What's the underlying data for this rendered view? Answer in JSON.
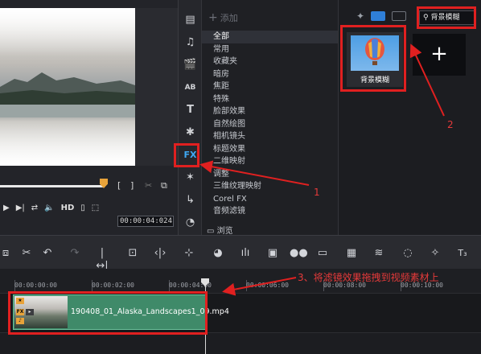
{
  "preview": {
    "mark_in": "[",
    "mark_out": "]",
    "hd_label": "HD",
    "timecode": "00:00:04:024"
  },
  "library_toolbar": {
    "fx_label": "FX"
  },
  "categories": {
    "add_label": "添加",
    "items": [
      "全部",
      "常用",
      "收藏夹",
      "暗房",
      "焦距",
      "特殊",
      "脸部效果",
      "自然绘图",
      "相机镜头",
      "标题效果",
      "二维映射",
      "调整",
      "三维纹理映射",
      "Corel FX",
      "音频滤镜"
    ],
    "selected_index": 0,
    "browse_label": "浏览"
  },
  "library": {
    "search_value": "背景模糊",
    "thumbnail_label": "背景模糊",
    "add_tile_glyph": "+"
  },
  "ruler": {
    "labels": [
      "00:00:00:00",
      "00:00:02:00",
      "00:00:04:00",
      "00:00:06:00",
      "00:00:08:00",
      "00:00:10:00"
    ]
  },
  "timeline": {
    "clip_name": "190408_01_Alaska_Landscapes1_09.mp4",
    "badge_fx": "FX"
  },
  "annotations": {
    "label_1": "1",
    "label_2": "2",
    "label_3": "3、将滤镜效果拖拽到视频素材上"
  },
  "colors": {
    "annotation": "#e02020",
    "accent_blue": "#3fa9f5",
    "clip_green": "#3f8a69",
    "playhead": "#e8a33a"
  }
}
